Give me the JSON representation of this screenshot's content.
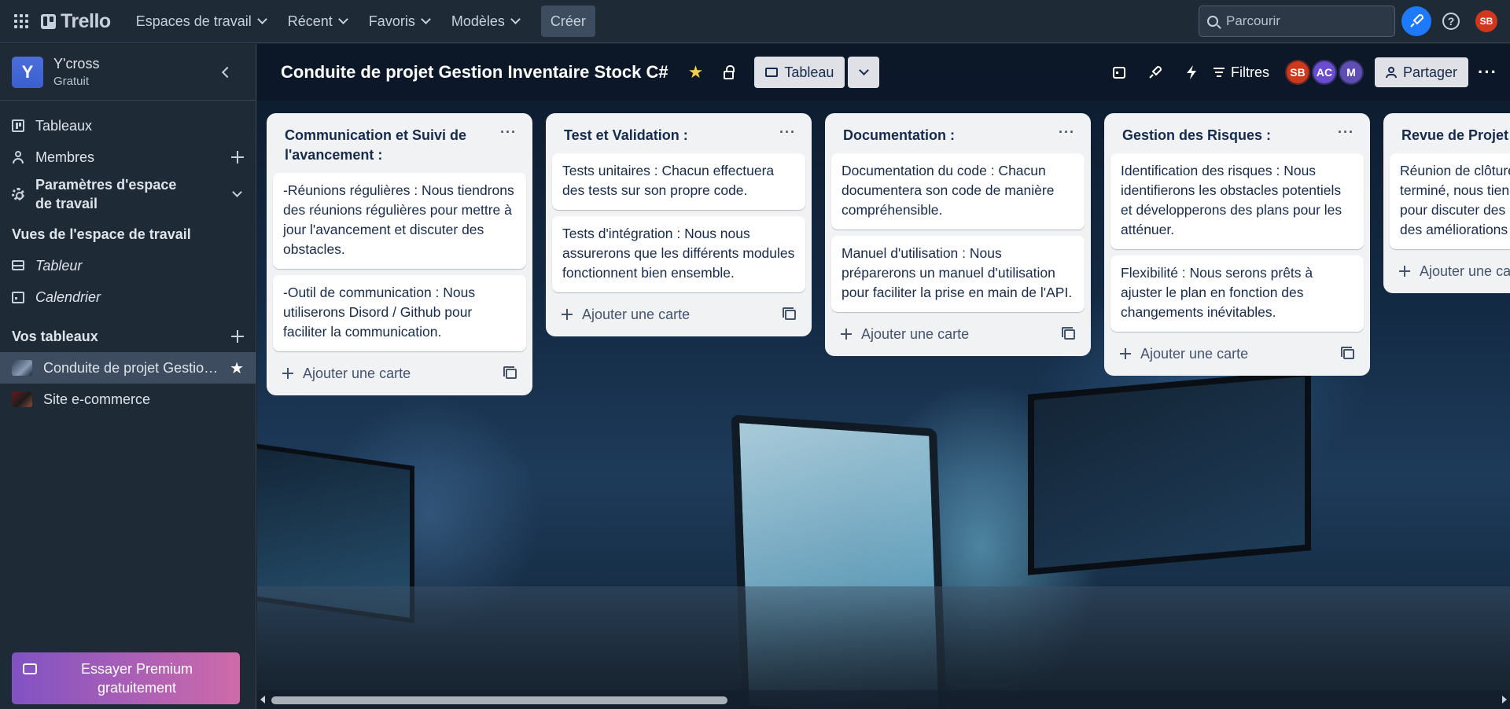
{
  "topbar": {
    "logo_text": "Trello",
    "nav": [
      "Espaces de travail",
      "Récent",
      "Favoris",
      "Modèles"
    ],
    "create_label": "Créer",
    "search_placeholder": "Parcourir",
    "help_label": "?",
    "user_initials": "SB"
  },
  "sidebar": {
    "workspace_initial": "Y",
    "workspace_name": "Y'cross",
    "workspace_plan": "Gratuit",
    "items": [
      {
        "label": "Tableaux",
        "icon": "board-icon"
      },
      {
        "label": "Membres",
        "icon": "person-icon"
      },
      {
        "label": "Paramètres d'espace de travail",
        "icon": "gear-icon"
      }
    ],
    "views_heading": "Vues de l'espace de travail",
    "views": [
      {
        "label": "Tableur",
        "icon": "table-icon"
      },
      {
        "label": "Calendrier",
        "icon": "calendar-icon"
      }
    ],
    "boards_heading": "Vos tableaux",
    "boards": [
      {
        "label": "Conduite de projet Gestion Inventaire Stock C#",
        "active": true
      },
      {
        "label": "Site e-commerce",
        "active": false
      }
    ],
    "premium_label": "Essayer Premium gratuitement"
  },
  "board": {
    "title": "Conduite de projet Gestion Inventaire Stock C#",
    "view_label": "Tableau",
    "filters_label": "Filtres",
    "share_label": "Partager",
    "members": [
      {
        "initials": "SB",
        "color": "#d0381c"
      },
      {
        "initials": "AC",
        "color": "#6a4bd1"
      },
      {
        "initials": "M",
        "color": "#5e4db2"
      }
    ],
    "add_card_label": "Ajouter une carte",
    "lists": [
      {
        "title": "Communication et Suivi de l'avancement :",
        "cards": [
          "-Réunions régulières : Nous tiendrons des réunions régulières pour mettre à jour l'avancement et discuter des obstacles.",
          "-Outil de communication : Nous utiliserons Disord / Github pour faciliter la communication."
        ]
      },
      {
        "title": "Test et Validation :",
        "cards": [
          "Tests unitaires : Chacun effectuera des tests sur son propre code.",
          "Tests d'intégration : Nous nous assurerons que les différents modules fonctionnent bien ensemble."
        ]
      },
      {
        "title": "Documentation :",
        "cards": [
          "Documentation du code : Chacun documentera son code de manière compréhensible.",
          "Manuel d'utilisation : Nous préparerons un manuel d'utilisation pour faciliter la prise en main de l'API."
        ]
      },
      {
        "title": "Gestion des Risques :",
        "cards": [
          "Identification des risques : Nous identifierons les obstacles potentiels et développerons des plans pour les atténuer.",
          "Flexibilité : Nous serons prêts à ajuster le plan en fonction des changements inévitables."
        ]
      },
      {
        "title": "Revue de Projet :",
        "cards": [
          "Réunion de clôture : Une fois le projet terminé, nous tiendrons une réunion pour discuter des leçons apprises et des améliorations possibles."
        ]
      }
    ]
  }
}
